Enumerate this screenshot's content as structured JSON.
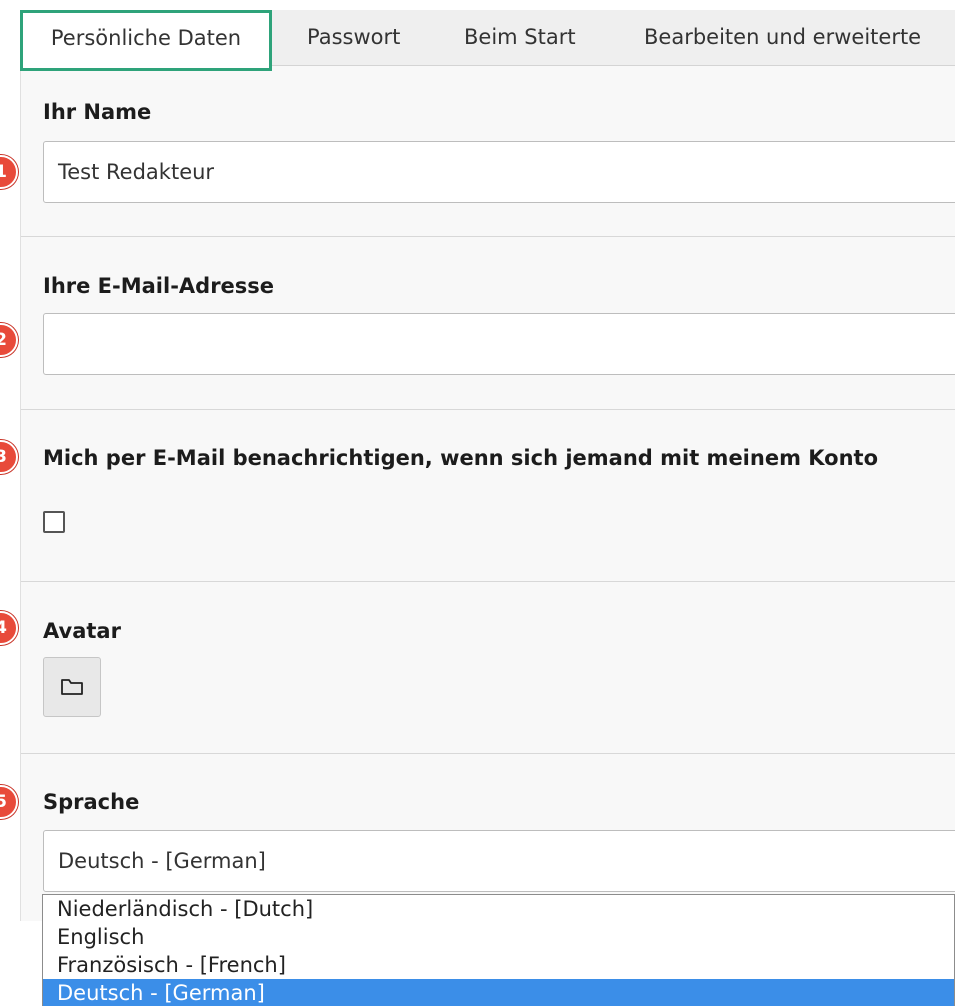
{
  "tabs": [
    {
      "label": "Persönliche Daten",
      "active": true
    },
    {
      "label": "Passwort"
    },
    {
      "label": "Beim Start"
    },
    {
      "label": "Bearbeiten und erweiterte"
    }
  ],
  "markers": [
    "1",
    "2",
    "3",
    "4",
    "5"
  ],
  "fields": {
    "name": {
      "label": "Ihr Name",
      "value": "Test Redakteur"
    },
    "email": {
      "label": "Ihre E-Mail-Adresse",
      "value": ""
    },
    "notify": {
      "label": "Mich per E-Mail benachrichtigen, wenn sich jemand mit meinem Konto",
      "checked": false
    },
    "avatar": {
      "label": "Avatar",
      "icon": "folder-icon"
    },
    "language": {
      "label": "Sprache",
      "value": "Deutsch - [German]",
      "options": [
        "Niederländisch - [Dutch]",
        "Englisch",
        "Französisch - [French]",
        "Deutsch - [German]"
      ],
      "selected_index": 3
    }
  },
  "colors": {
    "active_tab_border": "#2ea37a",
    "marker": "#e84a3a",
    "selected_option": "#3b8ee8"
  }
}
